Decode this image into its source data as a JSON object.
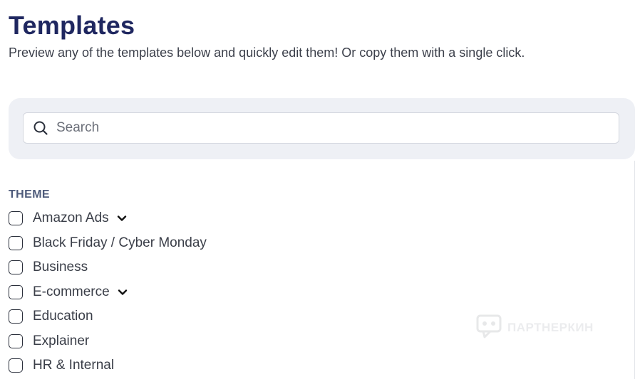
{
  "header": {
    "title": "Templates",
    "subtitle": "Preview any of the templates below and quickly edit them! Or copy them with a single click."
  },
  "search": {
    "placeholder": "Search",
    "value": "",
    "icon": "search-icon"
  },
  "filters": {
    "theme": {
      "heading": "THEME",
      "items": [
        {
          "label": "Amazon Ads",
          "checked": false,
          "expandable": true
        },
        {
          "label": "Black Friday / Cyber Monday",
          "checked": false,
          "expandable": false
        },
        {
          "label": "Business",
          "checked": false,
          "expandable": false
        },
        {
          "label": "E-commerce",
          "checked": false,
          "expandable": true
        },
        {
          "label": "Education",
          "checked": false,
          "expandable": false
        },
        {
          "label": "Explainer",
          "checked": false,
          "expandable": false
        },
        {
          "label": "HR & Internal",
          "checked": false,
          "expandable": false
        }
      ]
    }
  },
  "watermark": {
    "text": "ПАРТНЕРКИН"
  },
  "colors": {
    "title": "#1f2760",
    "panel_bg": "#eef0f5",
    "heading": "#4d5a7a"
  }
}
